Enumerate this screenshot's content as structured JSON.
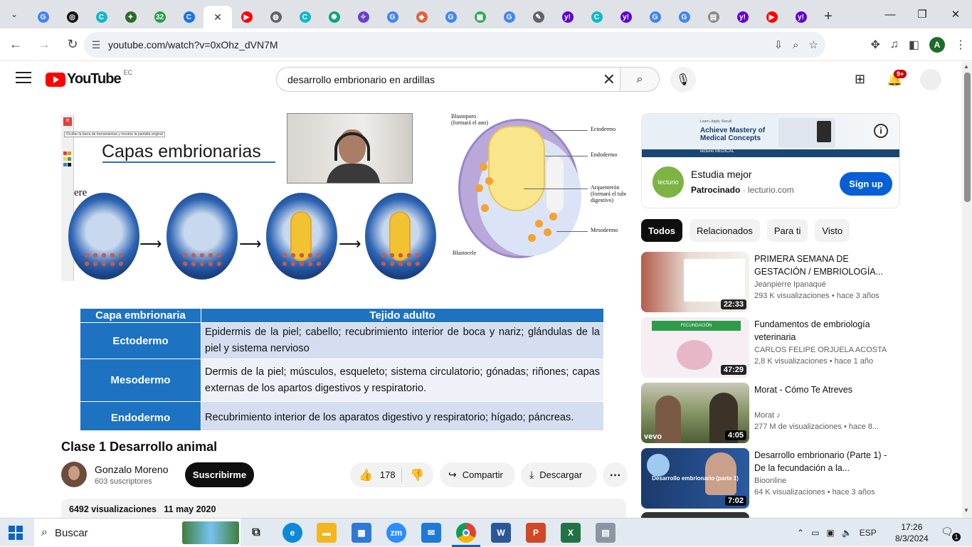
{
  "browser": {
    "tabs": [
      {
        "icon": "google-icon",
        "color": "#4285f4",
        "glyph": "G"
      },
      {
        "icon": "chatgpt-icon",
        "color": "#111111",
        "glyph": "◎"
      },
      {
        "icon": "canva-icon",
        "color": "#14b8c9",
        "glyph": "C"
      },
      {
        "icon": "app-icon",
        "color": "#2d6a2d",
        "glyph": "✦"
      },
      {
        "icon": "counter-icon",
        "color": "#2e9d4c",
        "glyph": "32"
      },
      {
        "icon": "canva-icon",
        "color": "#1a73e8",
        "glyph": "C"
      },
      {
        "icon": "youtube-icon",
        "color": "#ff0000",
        "glyph": "▶"
      },
      {
        "icon": "globe-icon",
        "color": "#5f6368",
        "glyph": "◍"
      },
      {
        "icon": "canva-icon",
        "color": "#14b8c9",
        "glyph": "C"
      },
      {
        "icon": "openai-icon",
        "color": "#10a37f",
        "glyph": "✺"
      },
      {
        "icon": "app-icon",
        "color": "#6a3fd0",
        "glyph": "✧"
      },
      {
        "icon": "google-icon",
        "color": "#4285f4",
        "glyph": "G"
      },
      {
        "icon": "app-icon",
        "color": "#e0623a",
        "glyph": "◆"
      },
      {
        "icon": "google-icon",
        "color": "#4285f4",
        "glyph": "G"
      },
      {
        "icon": "sheets-icon",
        "color": "#34a853",
        "glyph": "▦"
      },
      {
        "icon": "google-icon",
        "color": "#4285f4",
        "glyph": "G"
      },
      {
        "icon": "app-icon",
        "color": "#5f6368",
        "glyph": "✎"
      },
      {
        "icon": "yahoo-icon",
        "color": "#6001d2",
        "glyph": "y!"
      },
      {
        "icon": "canva-icon",
        "color": "#14b8c9",
        "glyph": "C"
      },
      {
        "icon": "yahoo-icon",
        "color": "#6001d2",
        "glyph": "y!"
      },
      {
        "icon": "google-icon",
        "color": "#4285f4",
        "glyph": "G"
      },
      {
        "icon": "google-icon",
        "color": "#4285f4",
        "glyph": "G"
      },
      {
        "icon": "app-icon",
        "color": "#8a8a8a",
        "glyph": "▤"
      },
      {
        "icon": "yahoo-icon",
        "color": "#6001d2",
        "glyph": "y!"
      },
      {
        "icon": "youtube-icon",
        "color": "#ff0000",
        "glyph": "▶"
      },
      {
        "icon": "yahoo-icon",
        "color": "#6001d2",
        "glyph": "y!"
      }
    ],
    "url": "youtube.com/watch?v=0xOhz_dVN7M",
    "profile_initial": "A"
  },
  "youtube": {
    "logo_text": "YouTube",
    "country_code": "EC",
    "search_query": "desarrollo embrionario en ardillas",
    "notifications_badge": "9+",
    "slide": {
      "title": "Capas embrionarias",
      "paint_tooltip": "Ocultar la barra de herramientas y mostrar la pantalla original",
      "fragment_text": "ere",
      "diagram_labels": {
        "blastoporo": "Blastoporo\n(formará el ano)",
        "ectodermo": "Ectodermo",
        "endodermo": "Endodermo",
        "arquenteron": "Arquenterón\n(formará el tubo\ndigestivo)",
        "mesodermo": "Mesodermo",
        "blastocele": "Blastocele"
      },
      "table": {
        "headers": [
          "Capa embrionaria",
          "Tejido adulto"
        ],
        "rows": [
          {
            "layer": "Ectodermo",
            "tissue": "Epidermis de la piel; cabello; recubrimiento interior de boca y nariz; glándulas de la piel y sistema nervioso"
          },
          {
            "layer": "Mesodermo",
            "tissue": "Dermis de la piel; músculos, esqueleto; sistema circulatorio; gónadas; riñones; capas externas de los apartos digestivos y respiratorio."
          },
          {
            "layer": "Endodermo",
            "tissue": "Recubrimiento interior de los aparatos digestivo y respiratorio; hígado; páncreas."
          }
        ]
      }
    },
    "video": {
      "title": "Clase 1 Desarrollo animal",
      "channel_name": "Gonzalo Moreno",
      "subscribers": "603 suscriptores",
      "subscribe_label": "Suscribirme",
      "likes": "178",
      "share_label": "Compartir",
      "download_label": "Descargar",
      "views": "6492 visualizaciones",
      "date": "11 may 2020"
    },
    "ad": {
      "banner_small": "Learn. Apply. Recall.",
      "banner_headline": "Achieve Mastery of Medical Concepts",
      "banner_brand": "lecturio MEDICAL",
      "logo_text": "lecturio",
      "title": "Estudia mejor",
      "sponsored": "Patrocinado",
      "domain": "lecturio.com",
      "cta": "Sign up"
    },
    "chips": [
      "Todos",
      "Relacionados",
      "Para ti",
      "Visto"
    ],
    "recommendations": [
      {
        "title": "PRIMERA SEMANA DE GESTACIÓN / EMBRIOLOGÍA...",
        "channel": "Jeanpierre Ipanaqué",
        "meta": "293 K visualizaciones  • hace 3 años",
        "duration": "22:33",
        "thumb_color": "#c4776a"
      },
      {
        "title": "Fundamentos de embriología veterinaria",
        "channel": "CARLOS FELIPE ORJUELA ACOSTA",
        "meta": "2,8 K visualizaciones  • hace 1 año",
        "duration": "47:29",
        "thumb_color": "#f0e6ec",
        "thumb_label": "FECUNDACIÓN"
      },
      {
        "title": "Morat - Cómo Te Atreves",
        "channel": "Morat ♪",
        "meta": "277 M de visualizaciones  • hace 8...",
        "duration": "4:05",
        "thumb_color": "#6b7d4a",
        "thumb_label": "vevo"
      },
      {
        "title": "Desarrollo embrionario (Parte 1) - De la fecundación a la...",
        "channel": "Bioonline",
        "meta": "64 K visualizaciones  • hace 3 años",
        "duration": "7:02",
        "thumb_color": "#1b3a6b",
        "thumb_label": "Desarrollo embrionario (parte 1)"
      }
    ]
  },
  "taskbar": {
    "search_placeholder": "Buscar",
    "language": "ESP",
    "time": "17:26",
    "date": "8/3/2024",
    "notification_count": "1"
  }
}
